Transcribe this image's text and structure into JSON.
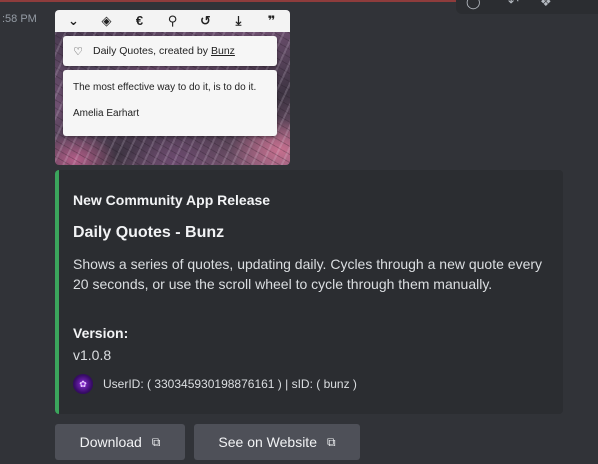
{
  "timestamp": ":58 PM",
  "app_image": {
    "toolbar_icons": [
      "chevron-down-icon",
      "diamond-icon",
      "euro-icon",
      "paperclip-icon",
      "history-icon",
      "download-icon",
      "quote-icon"
    ],
    "header_text": "Daily Quotes, created by",
    "header_link": "Bunz",
    "quote_text": "The most effective way to do it, is to do it.",
    "quote_author": "Amelia Earhart"
  },
  "embed": {
    "accent_color": "#3ba55c",
    "author": "New Community App Release",
    "title": "Daily Quotes - Bunz",
    "description": "Shows a series of quotes, updating daily. Cycles through a new quote every 20 seconds, or use the scroll wheel to cycle through them manually.",
    "field_name": "Version:",
    "field_value": "v1.0.8",
    "footer": "UserID: ( 330345930198876161 ) | sID: ( bunz )"
  },
  "buttons": {
    "download": "Download",
    "website": "See on Website"
  }
}
